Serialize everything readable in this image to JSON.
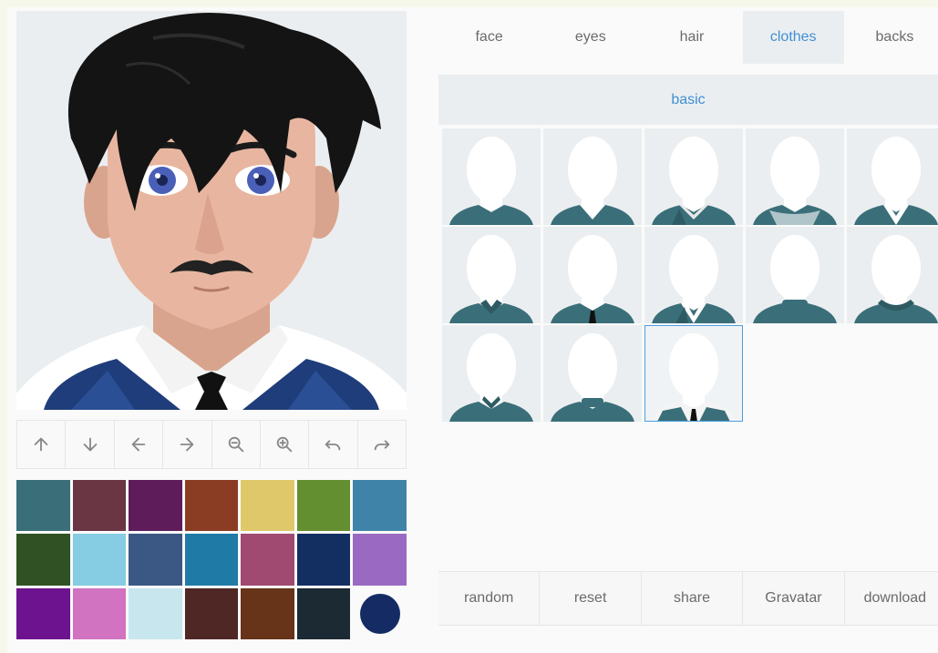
{
  "tabs": [
    {
      "label": "face",
      "active": false
    },
    {
      "label": "eyes",
      "active": false
    },
    {
      "label": "hair",
      "active": false
    },
    {
      "label": "clothes",
      "active": true
    },
    {
      "label": "backs",
      "active": false
    }
  ],
  "category": {
    "label": "basic"
  },
  "toolbar": {
    "icons": [
      "arrow-up-icon",
      "arrow-down-icon",
      "arrow-left-icon",
      "arrow-right-icon",
      "zoom-out-icon",
      "zoom-in-icon",
      "undo-icon",
      "redo-icon"
    ]
  },
  "palette": {
    "swatches": [
      "#3a6f79",
      "#6a3644",
      "#5e1c5a",
      "#8b3d24",
      "#dfc86a",
      "#648f31",
      "#3f84a8",
      "#2f5124",
      "#86cce2",
      "#3b5884",
      "#207aa6",
      "#a04a72",
      "#132f62",
      "#9a6ac2",
      "#6d138f",
      "#d173c0",
      "#c7e6ee",
      "#4f2826",
      "#673319",
      "#1c2a33"
    ],
    "selected_color": "#142c63"
  },
  "clothes": {
    "count": 13,
    "selected_index": 12,
    "primary_color": "#3a6f79"
  },
  "actions": [
    {
      "label": "random"
    },
    {
      "label": "reset"
    },
    {
      "label": "share"
    },
    {
      "label": "Gravatar"
    },
    {
      "label": "download"
    }
  ]
}
